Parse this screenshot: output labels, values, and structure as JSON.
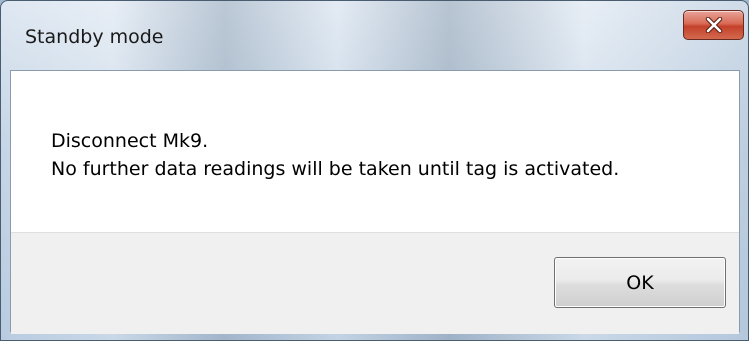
{
  "window": {
    "title": "Standby mode",
    "close_icon": "close-x-icon"
  },
  "message": {
    "line1": "Disconnect Mk9.",
    "line2": "No further data readings will be taken until tag is activated."
  },
  "buttons": {
    "ok_label": "OK"
  },
  "colors": {
    "close_button": "#c3412a",
    "content_background": "#ffffff",
    "footer_background": "#f0f0f0"
  }
}
